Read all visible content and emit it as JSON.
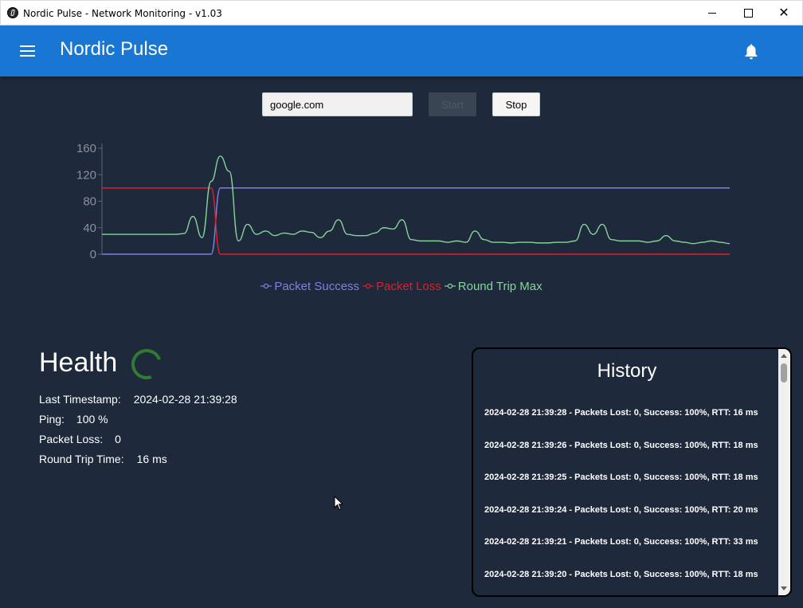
{
  "window": {
    "title": "Nordic Pulse - Network Monitoring - v1.03"
  },
  "appbar": {
    "title": "Nordic Pulse"
  },
  "controls": {
    "host_value": "google.com",
    "start_label": "Start",
    "stop_label": "Stop"
  },
  "chart_data": {
    "type": "line",
    "ylim": [
      0,
      160
    ],
    "yticks": [
      0,
      40,
      80,
      120,
      160
    ],
    "xlabel": "",
    "ylabel": "",
    "legend_position": "bottom",
    "series": [
      {
        "name": "Packet Success",
        "color": "#8080e0",
        "values": [
          0,
          0,
          0,
          0,
          0,
          0,
          0,
          0,
          0,
          0,
          0,
          0,
          0,
          100,
          100,
          100,
          100,
          100,
          100,
          100,
          100,
          100,
          100,
          100,
          100,
          100,
          100,
          100,
          100,
          100,
          100,
          100,
          100,
          100,
          100,
          100,
          100,
          100,
          100,
          100,
          100,
          100,
          100,
          100,
          100,
          100,
          100,
          100,
          100,
          100,
          100,
          100,
          100,
          100,
          100,
          100,
          100,
          100,
          100,
          100,
          100,
          100,
          100,
          100,
          100,
          100,
          100,
          100,
          100,
          100
        ]
      },
      {
        "name": "Packet Loss",
        "color": "#e01e2a",
        "values": [
          100,
          100,
          100,
          100,
          100,
          100,
          100,
          100,
          100,
          100,
          100,
          100,
          100,
          0,
          0,
          0,
          0,
          0,
          0,
          0,
          0,
          0,
          0,
          0,
          0,
          0,
          0,
          0,
          0,
          0,
          0,
          0,
          0,
          0,
          0,
          0,
          0,
          0,
          0,
          0,
          0,
          0,
          0,
          0,
          0,
          0,
          0,
          0,
          0,
          0,
          0,
          0,
          0,
          0,
          0,
          0,
          0,
          0,
          0,
          0,
          0,
          0,
          0,
          0,
          0,
          0,
          0,
          0,
          0,
          0
        ]
      },
      {
        "name": "Round Trip Max",
        "color": "#86d49a",
        "values": [
          30,
          30,
          30,
          30,
          30,
          30,
          30,
          30,
          30,
          31,
          57,
          25,
          110,
          148,
          125,
          20,
          45,
          30,
          35,
          28,
          32,
          30,
          35,
          33,
          25,
          35,
          52,
          30,
          28,
          28,
          32,
          40,
          38,
          52,
          22,
          20,
          20,
          20,
          18,
          20,
          18,
          35,
          22,
          18,
          18,
          17,
          18,
          18,
          17,
          17,
          18,
          18,
          20,
          45,
          30,
          45,
          22,
          20,
          20,
          20,
          18,
          20,
          28,
          20,
          18,
          16,
          18,
          20,
          18,
          16
        ]
      }
    ]
  },
  "health": {
    "title": "Health",
    "stats": [
      {
        "label": "Last Timestamp:",
        "value": "2024-02-28 21:39:28"
      },
      {
        "label": "Ping:",
        "value": "100 %"
      },
      {
        "label": "Packet Loss:",
        "value": "0"
      },
      {
        "label": "Round Trip Time:",
        "value": "16 ms"
      }
    ]
  },
  "history": {
    "title": "History",
    "entries": [
      "2024-02-28 21:39:28 - Packets Lost: 0, Success: 100%, RTT: 16 ms",
      "2024-02-28 21:39:26 - Packets Lost: 0, Success: 100%, RTT: 18 ms",
      "2024-02-28 21:39:25 - Packets Lost: 0, Success: 100%, RTT: 18 ms",
      "2024-02-28 21:39:24 - Packets Lost: 0, Success: 100%, RTT: 20 ms",
      "2024-02-28 21:39:21 - Packets Lost: 0, Success: 100%, RTT: 33 ms",
      "2024-02-28 21:39:20 - Packets Lost: 0, Success: 100%, RTT: 18 ms"
    ]
  },
  "colors": {
    "background": "#1e293b",
    "appbar": "#1976d2",
    "spinner": "#2e7d32"
  }
}
